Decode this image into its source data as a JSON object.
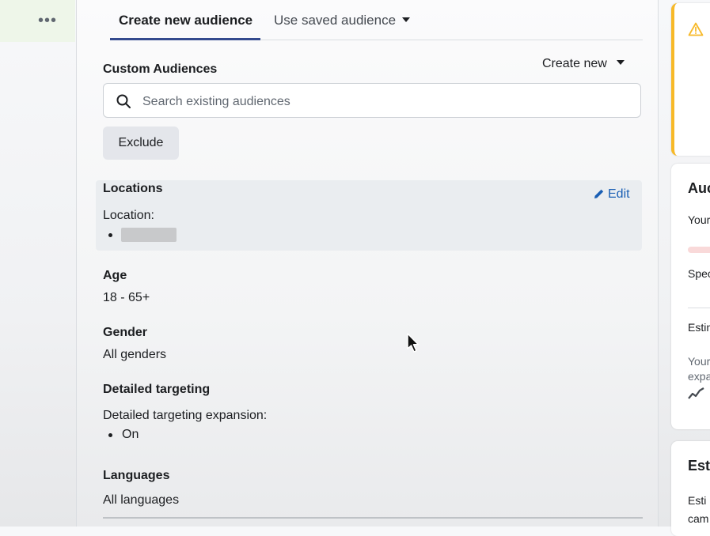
{
  "left_panel": {
    "more_icon": "more-horizontal-icon"
  },
  "tabs": [
    {
      "label": "Create new audience",
      "active": true
    },
    {
      "label": "Use saved audience",
      "active": false
    }
  ],
  "custom_audiences": {
    "title": "Custom Audiences",
    "create_new_label": "Create new",
    "search_placeholder": "Search existing audiences",
    "search_value": "",
    "exclude_label": "Exclude"
  },
  "locations": {
    "title": "Locations",
    "edit_label": "Edit",
    "location_label": "Location:"
  },
  "age": {
    "title": "Age",
    "value": "18 - 65+"
  },
  "gender": {
    "title": "Gender",
    "value": "All genders"
  },
  "detailed_targeting": {
    "title": "Detailed targeting",
    "expansion_label": "Detailed targeting expansion:",
    "expansion_value": "On"
  },
  "languages": {
    "title": "Languages",
    "value": "All languages"
  },
  "right_panel": {
    "audience_card_head": "Auc",
    "your_text": "Your",
    "spec_text": "Spec",
    "estim_text": "Estin",
    "your2_text": "Your",
    "expa_text": "expa",
    "estimates_head": "Esti",
    "esti_text": "Esti",
    "cam_text": "cam"
  },
  "colors": {
    "tab_underline": "#344a8e",
    "edit_link": "#1a5fb4",
    "warning": "#f7b928",
    "active_nav": "#eef6e9"
  }
}
